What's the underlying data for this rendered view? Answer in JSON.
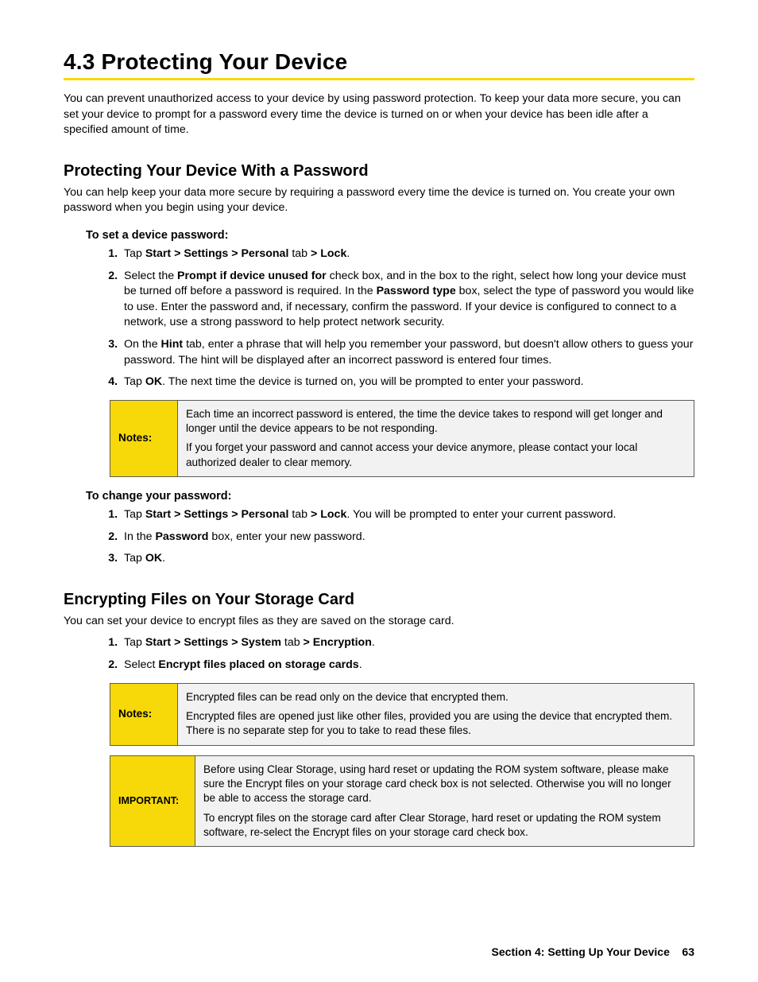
{
  "heading": "4.3  Protecting Your Device",
  "intro": "You can prevent unauthorized access to your device by using password protection. To keep your data more secure, you can set your device to prompt for a password every time the device is turned on or when your device has been idle after a specified amount of time.",
  "pw_section_title": "Protecting Your Device With a Password",
  "pw_intro": "You can help keep your data more secure by requiring a password every time the device is turned on. You create your own password when you begin using your device.",
  "set_pw_title": "To set a device password:",
  "step1_a": "Tap ",
  "step1_b": "Start > Settings > Personal",
  "step1_c": " tab ",
  "step1_d": "> Lock",
  "step1_e": ".",
  "step2_a": "Select the ",
  "step2_b": "Prompt if device unused for",
  "step2_c": " check box, and in the box to the right, select how long your device must be turned off before a password is required. In the ",
  "step2_d": "Password type",
  "step2_e": " box, select the type of password you would like to use. Enter the password and, if necessary, confirm the password. If your device is configured to connect to a network, use a strong password to help protect network security.",
  "step3_a": "On the ",
  "step3_b": "Hint",
  "step3_c": " tab, enter a phrase that will help you remember your password, but doesn't allow others to guess your password. The hint will be displayed after an incorrect password is entered four times.",
  "step4_a": "Tap ",
  "step4_b": "OK",
  "step4_c": ". The next time the device is turned on, you will be prompted to enter your password.",
  "notes_label": "Notes:",
  "note1_p1": "Each time an incorrect password is entered, the time the device takes to respond will get longer and longer until the device appears to be not responding.",
  "note1_p2": "If you forget your password and cannot access your device anymore, please contact your local authorized dealer to clear memory.",
  "change_pw_title": "To change your password:",
  "cstep1_a": "Tap ",
  "cstep1_b": "Start > Settings > Personal",
  "cstep1_c": " tab ",
  "cstep1_d": "> Lock",
  "cstep1_e": ". You will be prompted to enter your current password.",
  "cstep2_a": "In the ",
  "cstep2_b": "Password",
  "cstep2_c": " box, enter your new password.",
  "cstep3_a": "Tap ",
  "cstep3_b": "OK",
  "cstep3_c": ".",
  "enc_section_title": "Encrypting Files on Your Storage Card",
  "enc_intro": "You can set your device to encrypt files as they are saved on the storage card.",
  "estep1_a": "Tap ",
  "estep1_b": "Start > Settings > System",
  "estep1_c": " tab ",
  "estep1_d": "> Encryption",
  "estep1_e": ".",
  "estep2_a": "Select ",
  "estep2_b": "Encrypt files placed on storage cards",
  "estep2_c": ".",
  "note2_p1": "Encrypted files can be read only on the device that encrypted them.",
  "note2_p2": "Encrypted files are opened just like other files, provided you are using the device that encrypted them. There is no separate step for you to take to read these files.",
  "important_label": "IMPORTANT:",
  "imp_p1": "Before using Clear Storage, using hard reset or updating the ROM system software, please make sure the Encrypt files on your storage card check box is not selected. Otherwise you will no longer be able to access the storage card.",
  "imp_p2": "To encrypt files on the storage card after Clear Storage, hard reset or updating the ROM system software, re-select the Encrypt files on your storage card check box.",
  "footer_section": "Section 4: Setting Up Your Device",
  "footer_page": "63"
}
